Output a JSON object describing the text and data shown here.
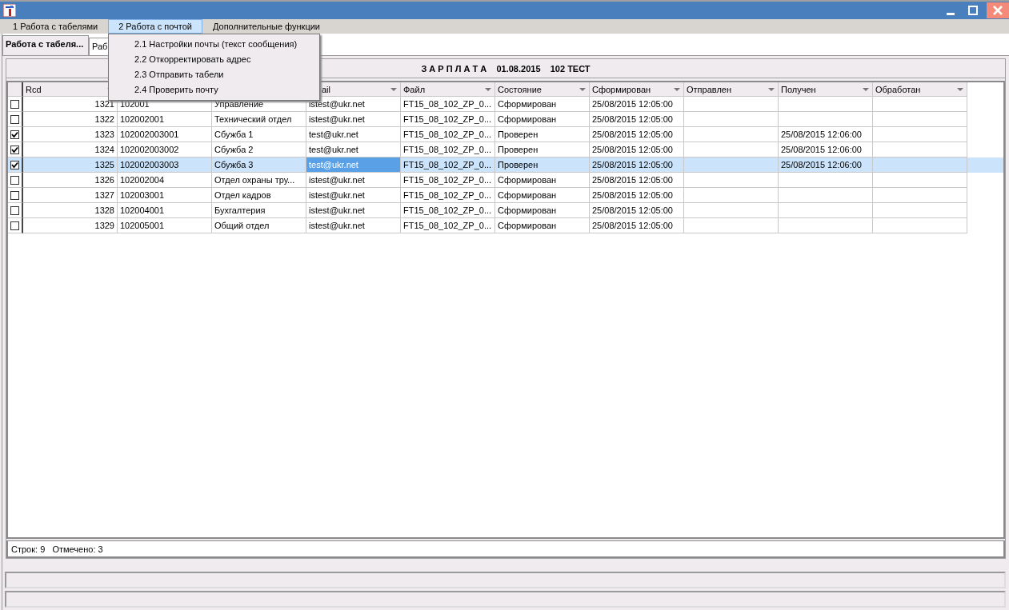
{
  "menu_bar": [
    {
      "label": "1 Работа с табелями",
      "selected": false
    },
    {
      "label": "2 Работа с почтой",
      "selected": true
    },
    {
      "label": "Дополнительные функции",
      "selected": false
    }
  ],
  "dropdown": [
    "2.1 Настройки почты (текст сообщения)",
    "2.2 Откорректировать адрес",
    "2.3 Отправить табели",
    "2.4 Проверить почту"
  ],
  "tabs": [
    {
      "label": "Работа с табеля...",
      "selected": true
    },
    {
      "label": "Раб",
      "selected": false
    }
  ],
  "panel_title": "З А Р П Л А Т А    01.08.2015    102 ТЕСТ",
  "table": {
    "columns": [
      {
        "label": "Rcd"
      },
      {},
      {},
      {
        "label": "ail"
      },
      {
        "label": "Файл"
      },
      {
        "label": "Состояние"
      },
      {
        "label": "Сформирован"
      },
      {
        "label": "Отправлен"
      },
      {
        "label": "Получен"
      },
      {
        "label": "Обработан"
      }
    ],
    "rows": [
      {
        "checked": false,
        "selected": false,
        "email_focused": false,
        "cells": [
          "1321",
          "102001",
          "Управление",
          "istest@ukr.net",
          "FT15_08_102_ZP_0...",
          "Сформирован",
          "25/08/2015 12:05:00",
          "",
          "",
          ""
        ]
      },
      {
        "checked": false,
        "selected": false,
        "email_focused": false,
        "cells": [
          "1322",
          "102002001",
          "Технический отдел",
          "istest@ukr.net",
          "FT15_08_102_ZP_0...",
          "Сформирован",
          "25/08/2015 12:05:00",
          "",
          "",
          ""
        ]
      },
      {
        "checked": true,
        "selected": false,
        "email_focused": false,
        "cells": [
          "1323",
          "102002003001",
          "Сбужба 1",
          "test@ukr.net",
          "FT15_08_102_ZP_0...",
          "Проверен",
          "25/08/2015 12:05:00",
          "",
          "25/08/2015 12:06:00",
          ""
        ]
      },
      {
        "checked": true,
        "selected": false,
        "email_focused": false,
        "cells": [
          "1324",
          "102002003002",
          "Сбужба 2",
          "test@ukr.net",
          "FT15_08_102_ZP_0...",
          "Проверен",
          "25/08/2015 12:05:00",
          "",
          "25/08/2015 12:06:00",
          ""
        ]
      },
      {
        "checked": true,
        "selected": true,
        "email_focused": true,
        "cells": [
          "1325",
          "102002003003",
          "Сбужба 3",
          "test@ukr.net",
          "FT15_08_102_ZP_0...",
          "Проверен",
          "25/08/2015 12:05:00",
          "",
          "25/08/2015 12:06:00",
          ""
        ]
      },
      {
        "checked": false,
        "selected": false,
        "email_focused": false,
        "cells": [
          "1326",
          "102002004",
          "Отдел охраны тру...",
          "istest@ukr.net",
          "FT15_08_102_ZP_0...",
          "Сформирован",
          "25/08/2015 12:05:00",
          "",
          "",
          ""
        ]
      },
      {
        "checked": false,
        "selected": false,
        "email_focused": false,
        "cells": [
          "1327",
          "102003001",
          "Отдел кадров",
          "istest@ukr.net",
          "FT15_08_102_ZP_0...",
          "Сформирован",
          "25/08/2015 12:05:00",
          "",
          "",
          ""
        ]
      },
      {
        "checked": false,
        "selected": false,
        "email_focused": false,
        "cells": [
          "1328",
          "102004001",
          "Бухгалтерия",
          "istest@ukr.net",
          "FT15_08_102_ZP_0...",
          "Сформирован",
          "25/08/2015 12:05:00",
          "",
          "",
          ""
        ]
      },
      {
        "checked": false,
        "selected": false,
        "email_focused": false,
        "cells": [
          "1329",
          "102005001",
          "Общий отдел",
          "istest@ukr.net",
          "FT15_08_102_ZP_0...",
          "Сформирован",
          "25/08/2015 12:05:00",
          "",
          "",
          ""
        ]
      }
    ]
  },
  "footer": "Строк: 9   Отмечено: 3"
}
